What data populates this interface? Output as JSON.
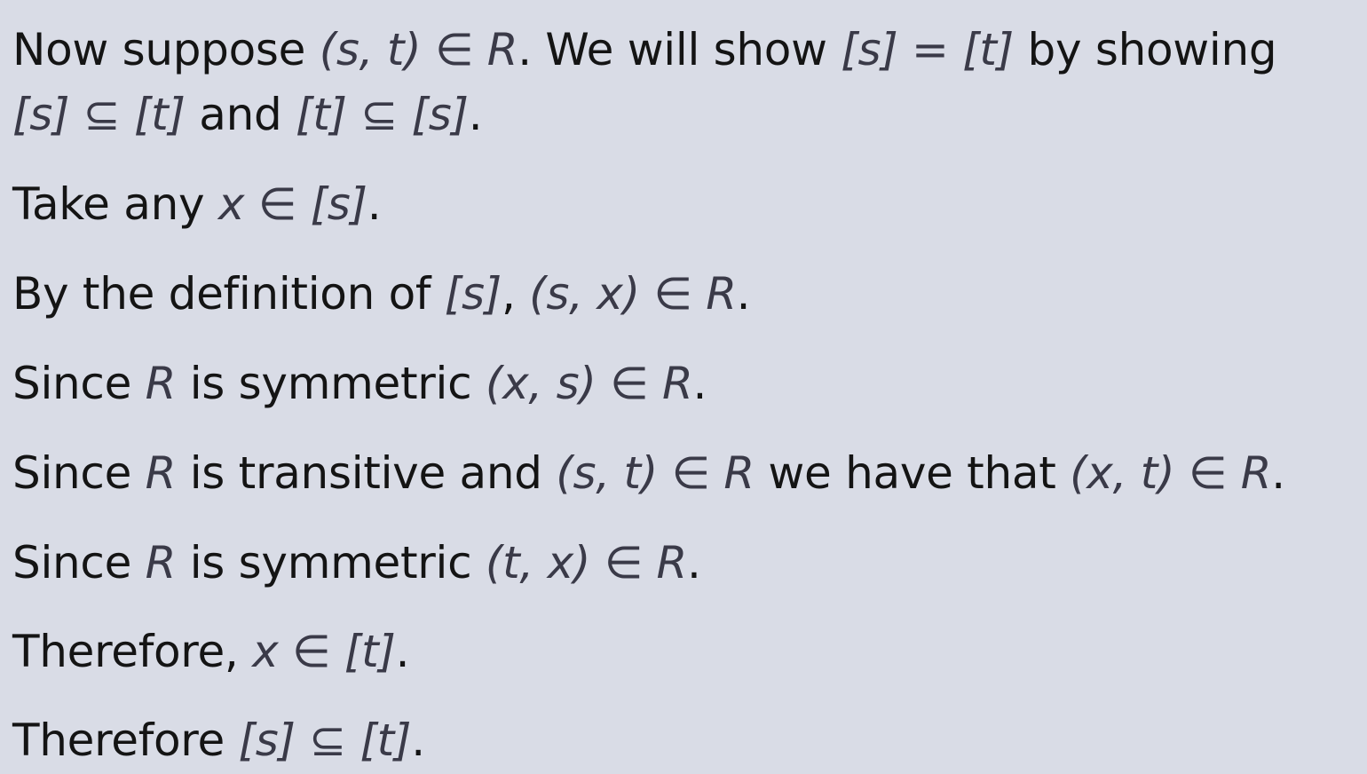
{
  "lines": [
    {
      "text": "Now suppose ",
      "m1": "(s, t) ∈ R",
      "t2": ". We will show ",
      "m2": "[s] = [t]",
      "t3": " by showing"
    },
    {
      "m1": "[s] ⊆ [t]",
      "t1": " and ",
      "m2": "[t] ⊆ [s]",
      "t2": "."
    },
    {
      "text": "Take any ",
      "m1": "x ∈ [s]",
      "t2": "."
    },
    {
      "text": "By the definition of ",
      "m1": "[s]",
      "t2": ", ",
      "m2": "(s, x) ∈ R",
      "t3": "."
    },
    {
      "text": "Since ",
      "m1": "R",
      "t2": " is symmetric ",
      "m2": "(x, s) ∈ R",
      "t3": "."
    },
    {
      "text": "Since ",
      "m1": "R",
      "t2": " is transitive and ",
      "m2": "(s, t) ∈ R",
      "t3": " we have that ",
      "m3": "(x, t) ∈ R",
      "t4": "."
    },
    {
      "text": "Since ",
      "m1": "R",
      "t2": " is symmetric ",
      "m2": "(t, x) ∈ R",
      "t3": "."
    },
    {
      "text": "Therefore, ",
      "m1": "x ∈ [t]",
      "t2": "."
    },
    {
      "text": "Therefore ",
      "m1": "[s] ⊆ [t]",
      "t2": "."
    }
  ]
}
